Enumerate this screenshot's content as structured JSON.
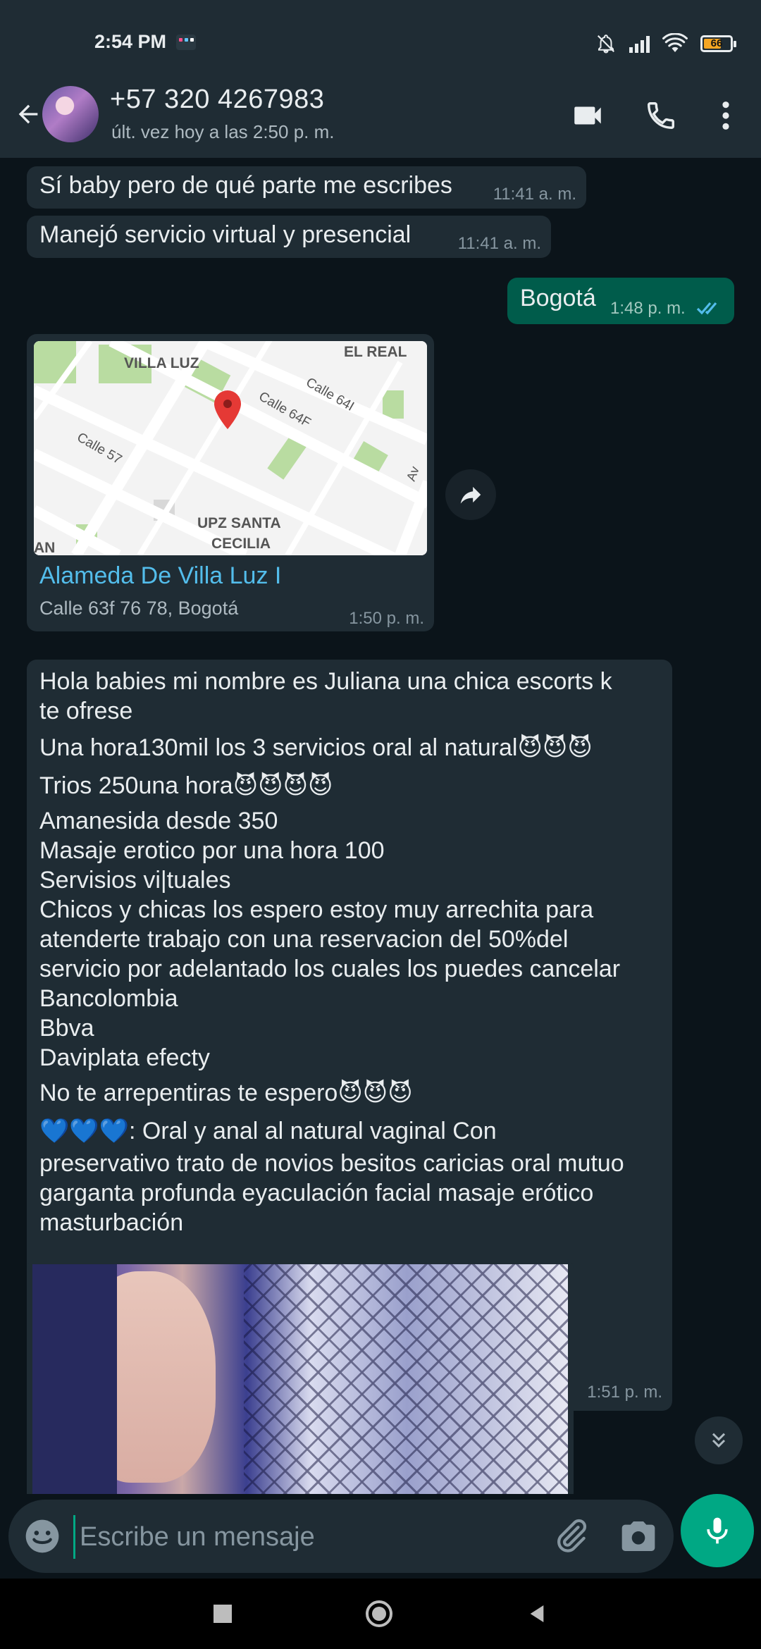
{
  "status_bar": {
    "time": "2:54 PM",
    "battery_level": "66",
    "icons": [
      "app-notification-icon",
      "bell-off-icon",
      "signal-icon",
      "wifi-icon",
      "battery-icon"
    ]
  },
  "header": {
    "contact_name": "+57 320 4267983",
    "last_seen": "últ. vez hoy a las 2:50 p. m.",
    "icons": [
      "back-arrow-icon",
      "video-call-icon",
      "voice-call-icon",
      "more-options-icon"
    ]
  },
  "messages": [
    {
      "direction": "in",
      "text": "Sí baby pero de qué parte me escribes",
      "time": "11:41 a. m."
    },
    {
      "direction": "in",
      "text": "Manejó servicio virtual y presencial",
      "time": "11:41 a. m."
    },
    {
      "direction": "out",
      "text": "Bogotá",
      "time": "1:48 p. m.",
      "status": "read"
    },
    {
      "direction": "in",
      "type": "location",
      "map_labels": [
        "VILLA LUZ",
        "EL REAL",
        "Calle 64I",
        "Calle 64F",
        "Calle 57",
        "UPZ SANTA",
        "CECILIA",
        "AN",
        "Av"
      ],
      "place_name": "Alameda De Villa Luz I",
      "address": "Calle 63f 76 78, Bogotá",
      "time": "1:50 p. m."
    },
    {
      "direction": "in",
      "lines": [
        "Hola babies mi nombre es Juliana  una chica escorts k",
        "te ofrese",
        "Una hora130mil los 3 servicios oral al natural😈😈😈",
        "Trios 250una  hora😈😈😈😈",
        "Amanesida desde 350",
        "Masaje erotico por una hora 100",
        "Servisios vi|tuales",
        "Chicos y chicas los espero estoy muy arrechita para",
        "atenderte trabajo con una reservacion del 50%del",
        "servicio por adelantado los cuales los puedes cancelar",
        "Bancolombia",
        "Bbva",
        "Daviplata efecty",
        "No te arrepentiras te espero😈😈😈",
        "💙💙💙: Oral y anal al natural vaginal Con",
        "preservativo trato de novios besitos caricias oral mutuo",
        "garganta profunda eyaculación facial masaje erótico",
        "masturbación"
      ],
      "time": "1:51 p. m."
    },
    {
      "direction": "in",
      "type": "image"
    }
  ],
  "input": {
    "placeholder": "Escribe un mensaje",
    "value": "",
    "icons": [
      "emoji-icon",
      "attach-icon",
      "camera-icon",
      "mic-icon"
    ]
  },
  "nav_bar": {
    "icons": [
      "recents-square-icon",
      "home-circle-icon",
      "back-triangle-icon"
    ]
  },
  "colors": {
    "background": "#0b141a",
    "header": "#1f2c34",
    "incoming_bubble": "#1f2c34",
    "outgoing_bubble": "#005c4b",
    "accent": "#00a884",
    "link": "#53bdeb",
    "read_ticks": "#53bdeb"
  }
}
